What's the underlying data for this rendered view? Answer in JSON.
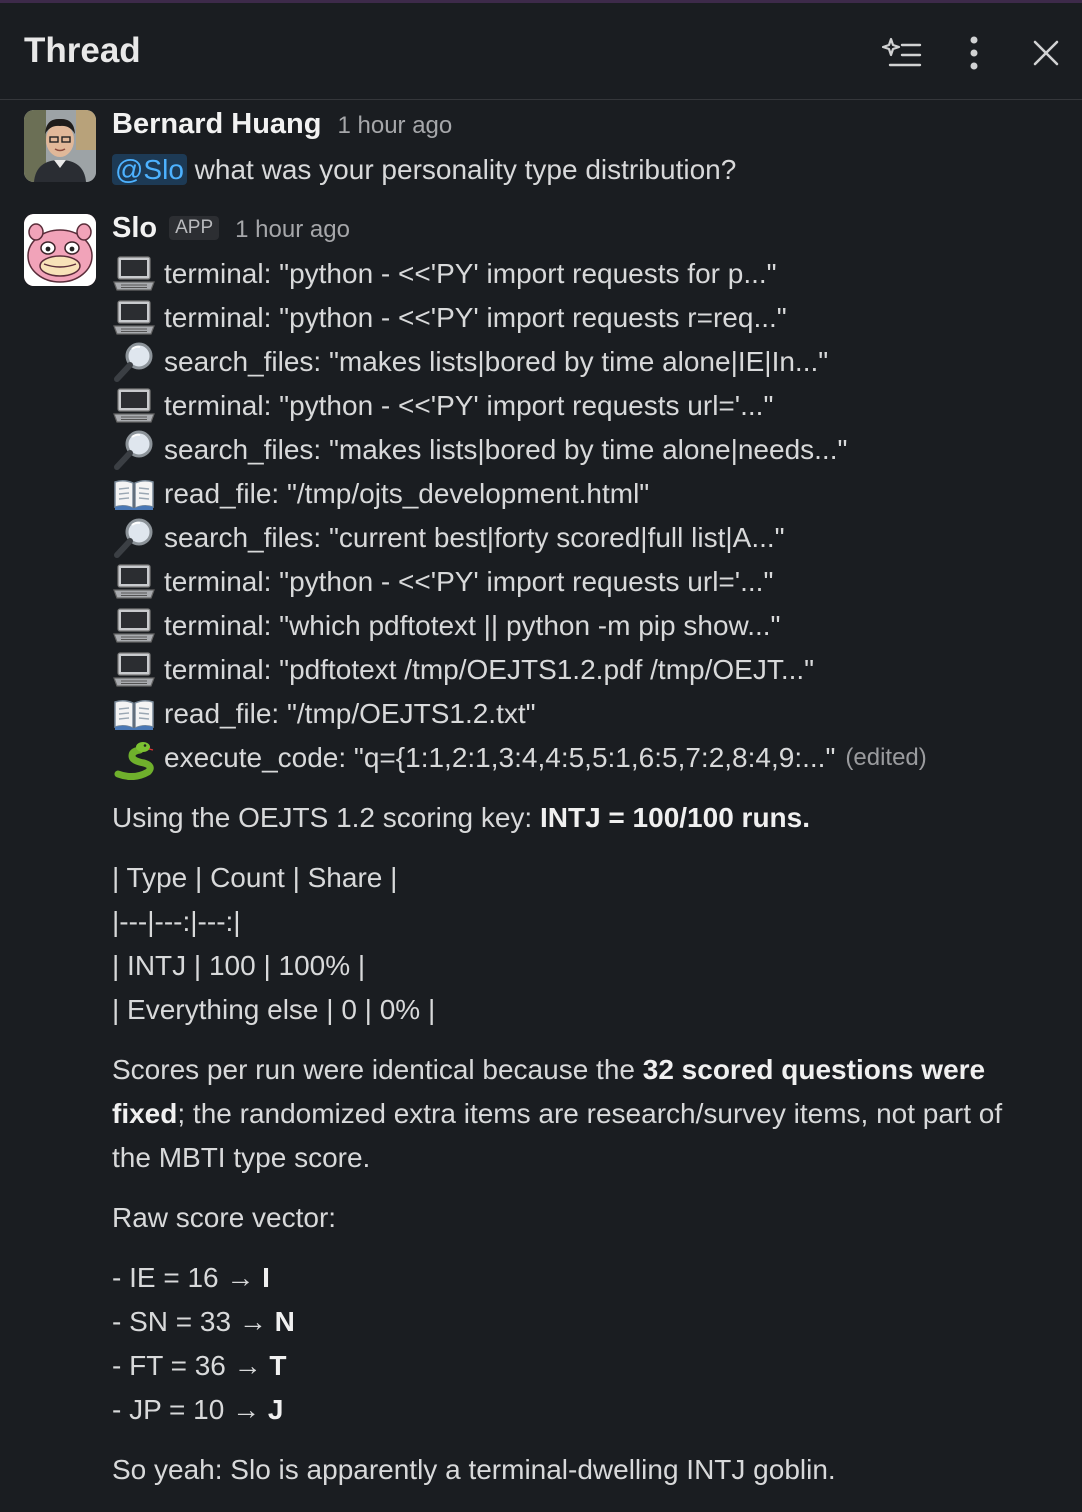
{
  "header": {
    "title": "Thread"
  },
  "messages": [
    {
      "author": "Bernard Huang",
      "time": "1 hour ago",
      "mention": "@Slo",
      "text": " what was your personality type distribution?"
    },
    {
      "author": "Slo",
      "badge": "APP",
      "time": "1 hour ago",
      "tools": [
        {
          "icon": "laptop-icon",
          "text": "terminal: \"python - <<'PY' import requests for p...\""
        },
        {
          "icon": "laptop-icon",
          "text": "terminal: \"python - <<'PY' import requests r=req...\""
        },
        {
          "icon": "magnifier-icon",
          "text": "search_files: \"makes lists|bored by time alone|IE|In...\""
        },
        {
          "icon": "laptop-icon",
          "text": "terminal: \"python - <<'PY' import requests url='...\""
        },
        {
          "icon": "magnifier-icon",
          "text": "search_files: \"makes lists|bored by time alone|needs...\""
        },
        {
          "icon": "book-icon",
          "text": "read_file: \"/tmp/ojts_development.html\""
        },
        {
          "icon": "magnifier-icon",
          "text": "search_files: \"current best|forty scored|full list|A...\""
        },
        {
          "icon": "laptop-icon",
          "text": "terminal: \"python - <<'PY' import requests url='...\""
        },
        {
          "icon": "laptop-icon",
          "text": "terminal: \"which pdftotext || python -m pip show...\""
        },
        {
          "icon": "laptop-icon",
          "text": "terminal: \"pdftotext /tmp/OEJTS1.2.pdf /tmp/OEJT...\""
        },
        {
          "icon": "book-icon",
          "text": "read_file: \"/tmp/OEJTS1.2.txt\""
        },
        {
          "icon": "snake-icon",
          "text": "execute_code: \"q={1:1,2:1,3:4,4:5,5:1,6:5,7:2,8:4,9:...\"",
          "edited": "(edited)"
        }
      ],
      "body": {
        "p1_prefix": "Using the OEJTS 1.2 scoring key: ",
        "p1_bold": "INTJ = 100/100 runs.",
        "table_lines": [
          "| Type | Count | Share |",
          "|---|---:|---:|",
          "| INTJ | 100 | 100% |",
          "| Everything else | 0 | 0% |"
        ],
        "p2_line1_prefix": "Scores per run were identical because the ",
        "p2_line1_bold": "32 scored questions were",
        "p2_line2_bold": "fixed",
        "p2_line2_rest": "; the randomized extra items are research/survey items, not part of",
        "p2_line3": "the MBTI type score.",
        "p3": "Raw score vector:",
        "scores": [
          {
            "text": "- IE = 16 → ",
            "letter": "I"
          },
          {
            "text": "- SN = 33 → ",
            "letter": "N"
          },
          {
            "text": "- FT = 36 → ",
            "letter": "T"
          },
          {
            "text": "- JP = 10 → ",
            "letter": "J"
          }
        ],
        "closing": "So yeah: Slo is apparently a terminal-dwelling INTJ goblin."
      }
    }
  ]
}
